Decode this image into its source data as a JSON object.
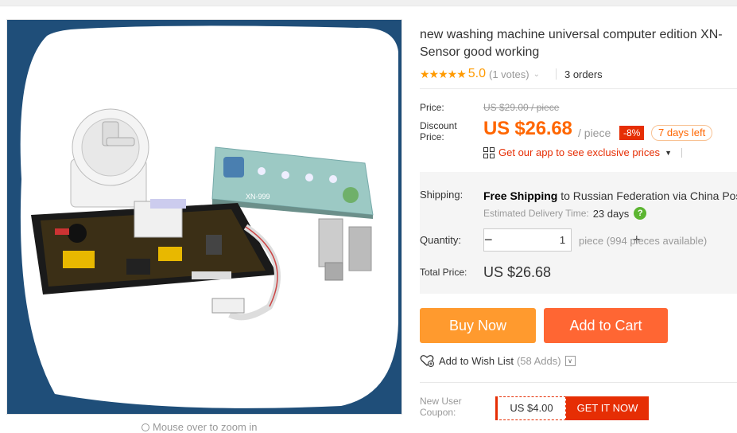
{
  "product": {
    "title_line1": "new washing machine universal computer edition XN-",
    "title_line2": "Sensor good working",
    "stars": "★★★★★",
    "score": "5.0",
    "votes": "(1 votes)",
    "orders": "3 orders"
  },
  "gallery": {
    "zoom_hint": "Mouse over to zoom in",
    "panel_label": "XN-999"
  },
  "price": {
    "price_label": "Price:",
    "original": "US $29.00 / piece",
    "discount_label_1": "Discount",
    "discount_label_2": "Price:",
    "discounted": "US $26.68",
    "per_unit": "/ piece",
    "discount_pct": "-8%",
    "days_left": "7 days left",
    "app_promo": "Get our app to see exclusive prices"
  },
  "shipping": {
    "label": "Shipping:",
    "free": "Free Shipping",
    "destination": " to Russian Federation via China Pos",
    "estimate_label": "Estimated Delivery Time:",
    "estimate_value": "23 days"
  },
  "quantity": {
    "label": "Quantity:",
    "minus": "−",
    "value": "1",
    "plus": "+",
    "available": "piece (994 pieces available)"
  },
  "total": {
    "label": "Total Price:",
    "value": "US $26.68"
  },
  "actions": {
    "buy_now": "Buy Now",
    "add_to_cart": "Add to Cart",
    "wishlist": "Add to Wish List",
    "wishlist_count": "(58 Adds)"
  },
  "coupon": {
    "label_1": "New User",
    "label_2": "Coupon:",
    "amount": "US $4.00",
    "cta": "GET IT NOW"
  },
  "colors": {
    "accent_orange": "#ff6600",
    "buy_now": "#ff9a2e",
    "add_to_cart": "#ff6633",
    "badge_red": "#e62e04",
    "star": "#ff9a00"
  }
}
